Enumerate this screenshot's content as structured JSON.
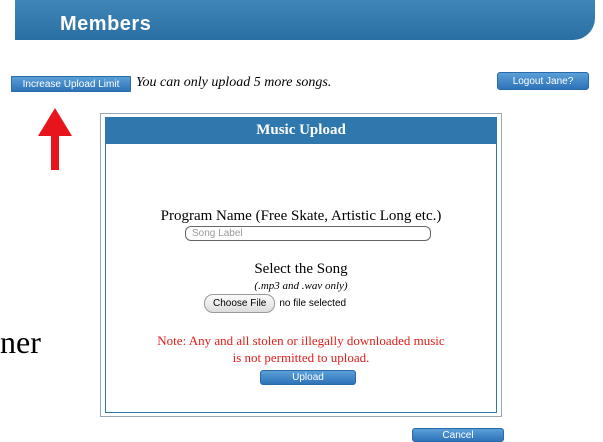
{
  "header": {
    "title": "Members"
  },
  "toolbar": {
    "increase_limit_label": "Increase Upload Limit",
    "upload_note": "You can only upload 5 more songs.",
    "logout_label": "Logout Jane?"
  },
  "side_text": "ner",
  "dialog": {
    "title": "Music Upload",
    "program_label": "Program Name (Free Skate, Artistic Long etc.)",
    "song_input": {
      "placeholder": "Song Label",
      "value": ""
    },
    "select_label": "Select the Song",
    "format_note": "(.mp3 and .wav only)",
    "choose_file_label": "Choose File",
    "file_status": "no file selected",
    "warning_line1": "Note: Any and all stolen or illegally downloaded music",
    "warning_line2": "is not permitted to upload.",
    "upload_label": "Upload",
    "cancel_label": "Cancel"
  },
  "colors": {
    "brand_blue": "#2f78ae",
    "warning_red": "#e0201c",
    "arrow_red": "#e8141c"
  },
  "icons": {
    "arrow": "up-arrow-icon"
  }
}
